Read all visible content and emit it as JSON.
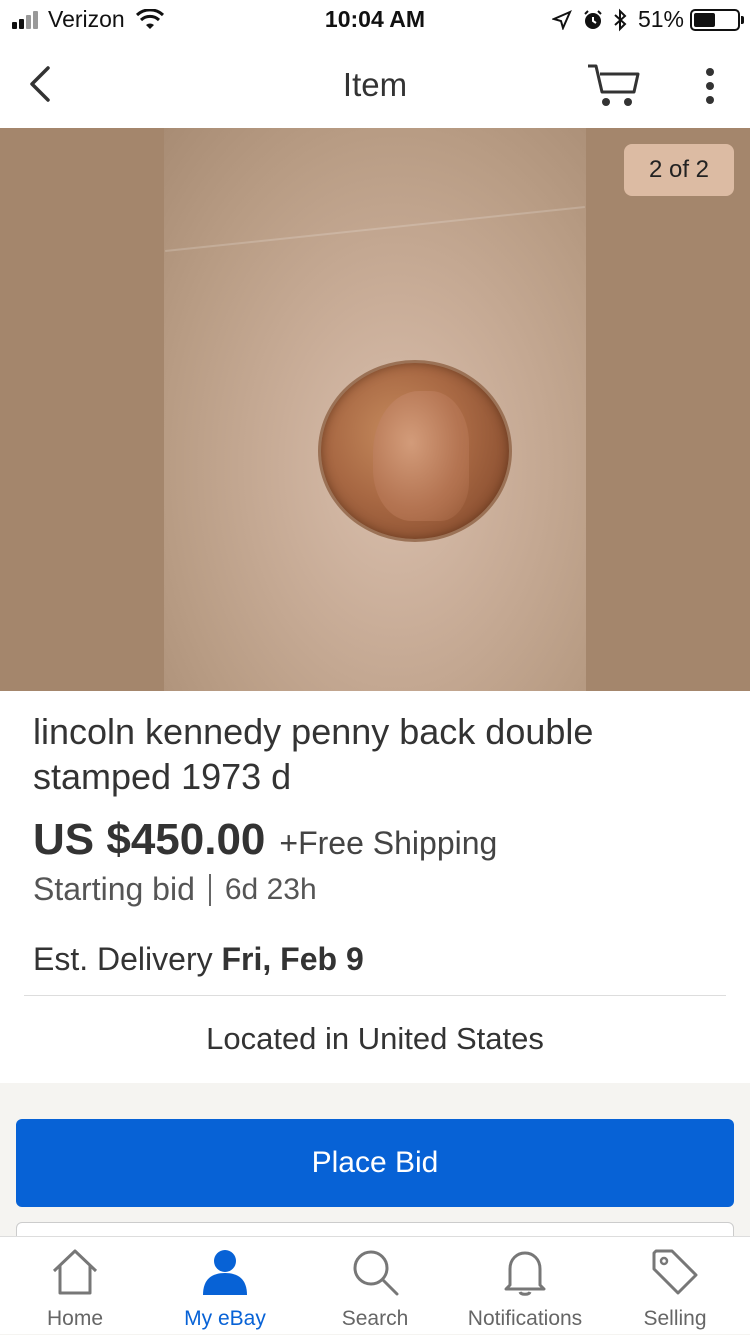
{
  "status_bar": {
    "carrier": "Verizon",
    "time": "10:04 AM",
    "battery": "51%",
    "battery_level": 0.51
  },
  "nav": {
    "title": "Item"
  },
  "gallery": {
    "counter": "2 of 2"
  },
  "item": {
    "title": "lincoln kennedy penny back double stamped 1973 d",
    "price": "US $450.00",
    "shipping": "+Free Shipping",
    "bid_type": "Starting bid",
    "time_left": "6d 23h",
    "delivery_label": "Est. Delivery",
    "delivery_date": "Fri, Feb 9",
    "location": "Located in United States"
  },
  "actions": {
    "place_bid": "Place Bid"
  },
  "tabs": [
    {
      "label": "Home",
      "icon": "home-icon",
      "active": false
    },
    {
      "label": "My eBay",
      "icon": "user-icon",
      "active": true
    },
    {
      "label": "Search",
      "icon": "search-icon",
      "active": false
    },
    {
      "label": "Notifications",
      "icon": "bell-icon",
      "active": false
    },
    {
      "label": "Selling",
      "icon": "tag-icon",
      "active": false
    }
  ],
  "colors": {
    "accent": "#0762d6",
    "counter_bg": "#dcbba3",
    "photo_bg": "#a4866c"
  }
}
